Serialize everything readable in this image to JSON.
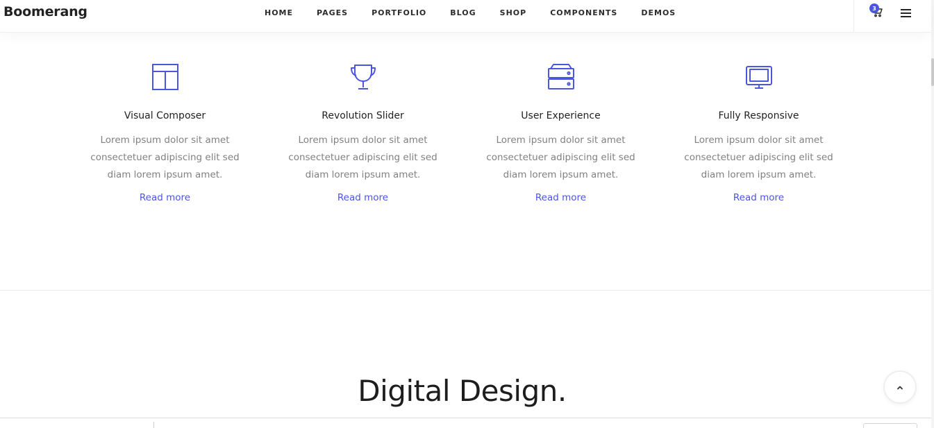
{
  "header": {
    "brand": "Boomerang",
    "nav": [
      "HOME",
      "PAGES",
      "PORTFOLIO",
      "BLOG",
      "SHOP",
      "COMPONENTS",
      "DEMOS"
    ],
    "cart_count": "3"
  },
  "features": [
    {
      "icon": "layout-icon",
      "title": "Visual Composer",
      "text": "Lorem ipsum dolor sit amet consectetuer adipiscing elit sed diam lorem ipsum amet.",
      "link": "Read more"
    },
    {
      "icon": "trophy-icon",
      "title": "Revolution Slider",
      "text": "Lorem ipsum dolor sit amet consectetuer adipiscing elit sed diam lorem ipsum amet.",
      "link": "Read more"
    },
    {
      "icon": "server-icon",
      "title": "User Experience",
      "text": "Lorem ipsum dolor sit amet consectetuer adipiscing elit sed diam lorem ipsum amet.",
      "link": "Read more"
    },
    {
      "icon": "monitor-icon",
      "title": "Fully Responsive",
      "text": "Lorem ipsum dolor sit amet consectetuer adipiscing elit sed diam lorem ipsum amet.",
      "link": "Read more"
    }
  ],
  "section_title": "Digital Design.",
  "colors": {
    "accent": "#4a55e0",
    "text": "#1f1f1f",
    "muted": "#808080"
  }
}
